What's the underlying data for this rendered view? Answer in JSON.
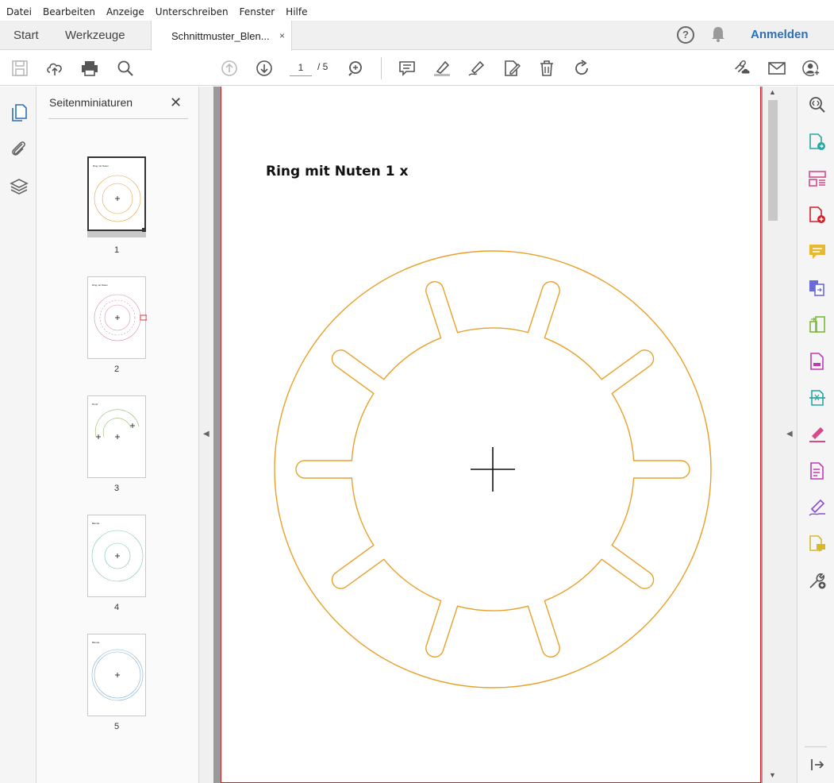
{
  "menu": [
    "Datei",
    "Bearbeiten",
    "Anzeige",
    "Unterschreiben",
    "Fenster",
    "Hilfe"
  ],
  "tabs": {
    "home": "Start",
    "tools": "Werkzeuge",
    "document": "Schnittmuster_Blen...",
    "close": "×"
  },
  "header": {
    "help": "?",
    "login": "Anmelden"
  },
  "toolbar": {
    "page_current": "1",
    "page_total": "/ 5"
  },
  "panel": {
    "title": "Seitenminiaturen",
    "close": "✕",
    "thumbnails": [
      {
        "num": "1",
        "label": "Ring mit Nuten",
        "color": "#e8a14a"
      },
      {
        "num": "2",
        "label": "Ring mit Nuten",
        "color": "#d88fa0"
      },
      {
        "num": "3",
        "label": "Rund",
        "color": "#8fba6a"
      },
      {
        "num": "4",
        "label": "Blende",
        "color": "#7fc4b0"
      },
      {
        "num": "5",
        "label": "Blende",
        "color": "#7fb0d8"
      }
    ]
  },
  "page": {
    "heading": "Ring mit Nuten 1 x",
    "pattern_color": "#e8a02a"
  },
  "colors": {
    "accent": "#2d6fb8",
    "page_border": "#d0202a"
  }
}
